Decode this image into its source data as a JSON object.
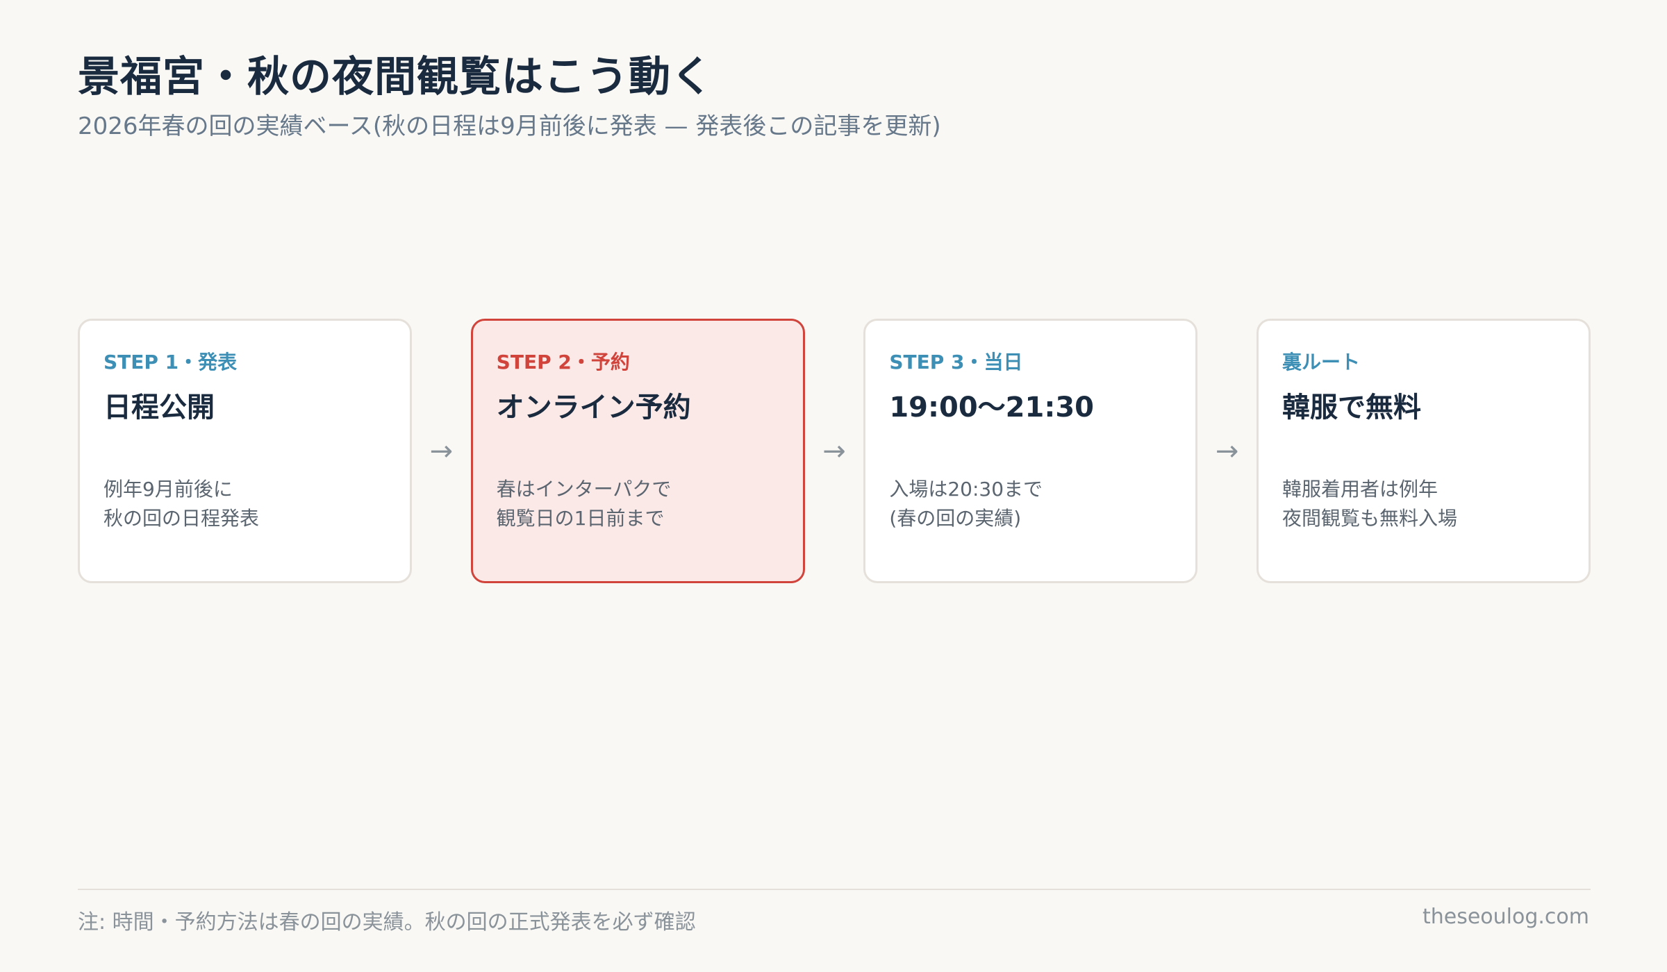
{
  "header": {
    "title": "景福宮・秋の夜間観覧はこう動く",
    "subtitle": "2026年春の回の実績ベース(秋の日程は9月前後に発表 — 発表後この記事を更新)"
  },
  "steps": [
    {
      "step_label": "STEP 1・発表",
      "heading": "日程公開",
      "desc_line1": "例年9月前後に",
      "desc_line2": "秋の回の日程発表"
    },
    {
      "step_label": "STEP 2・予約",
      "heading": "オンライン予約",
      "desc_line1": "春はインターパクで",
      "desc_line2": "観覧日の1日前まで"
    },
    {
      "step_label": "STEP 3・当日",
      "heading": "19:00〜21:30",
      "desc_line1": "入場は20:30まで",
      "desc_line2": "(春の回の実績)"
    },
    {
      "step_label": "裏ルート",
      "heading": "韓服で無料",
      "desc_line1": "韓服着用者は例年",
      "desc_line2": "夜間観覧も無料入場"
    }
  ],
  "arrow_glyph": "→",
  "footer": {
    "note": "注: 時間・予約方法は春の回の実績。秋の回の正式発表を必ず確認",
    "brand": "theseoulog.com"
  },
  "colors": {
    "background": "#f9f8f5",
    "accent_blue": "#3d8fb5",
    "accent_red": "#d0443c",
    "highlight_fill": "#fbe9e8",
    "title_navy": "#1b2b3f"
  }
}
